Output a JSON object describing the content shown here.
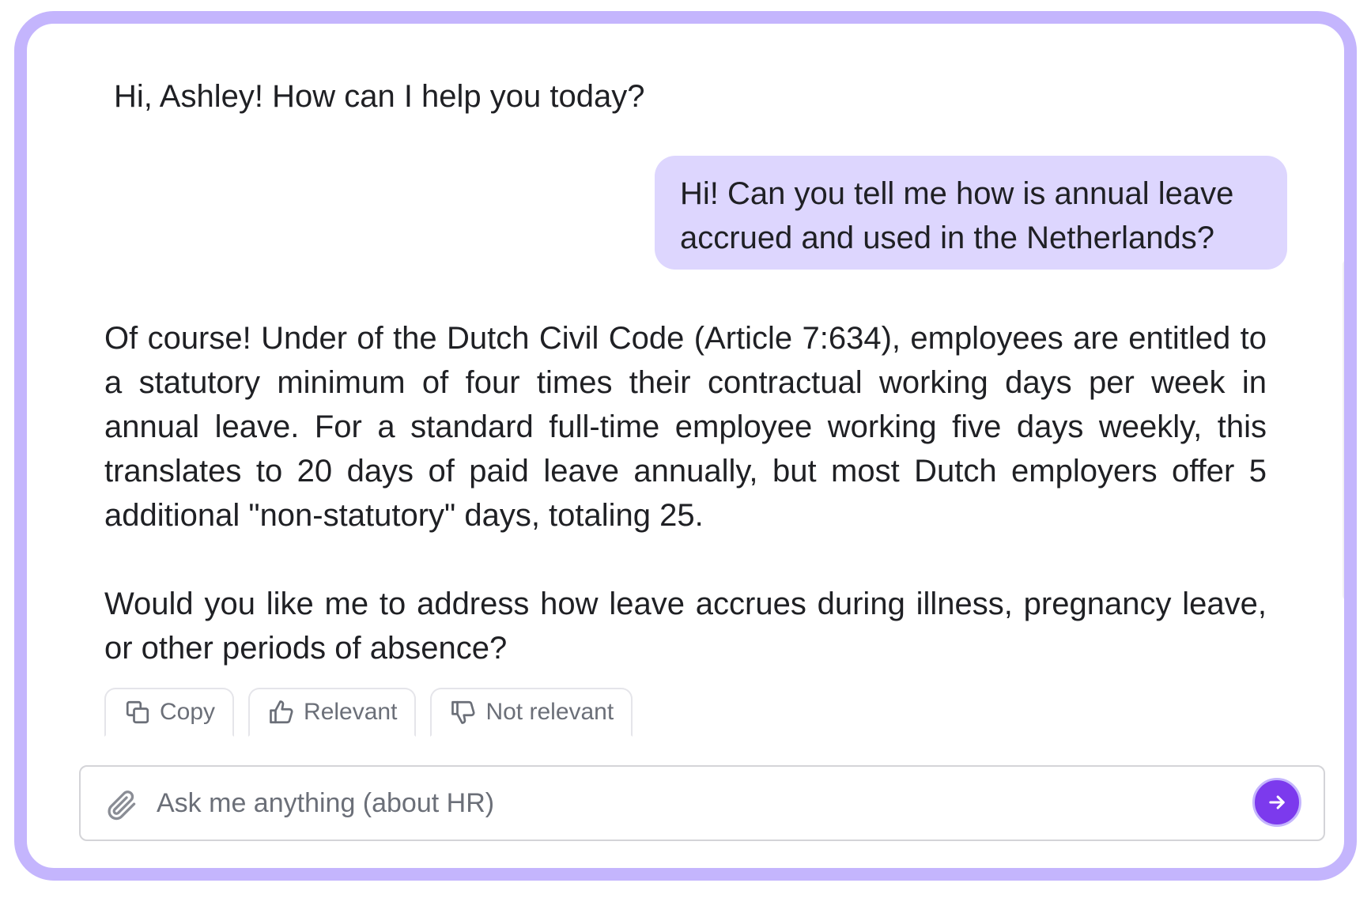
{
  "chat": {
    "greeting": "Hi, Ashley! How can I help you today?",
    "user_message_lines": [
      "Hi! Can you tell me how is annual leave",
      "accrued and used in the Netherlands?"
    ],
    "assistant_paragraphs": [
      "Of course! Under of the Dutch Civil Code (Article 7:634), employees are entitled to a statutory minimum of four times their contractual working days per week in annual leave. For a standard full-time employee working five days weekly, this translates to 20 days of paid leave annually, but most Dutch employers offer 5 additional \"non-statutory\" days, totaling 25.",
      "Would you like me to address how leave accrues during illness, pregnancy leave, or other periods of absence?"
    ]
  },
  "actions": {
    "copy_label": "Copy",
    "relevant_label": "Relevant",
    "not_relevant_label": "Not relevant"
  },
  "composer": {
    "placeholder": "Ask me anything (about HR)",
    "value": ""
  },
  "icons": {
    "copy": "copy-icon",
    "relevant": "thumbs-up-icon",
    "not_relevant": "thumbs-down-icon",
    "attach": "paperclip-icon",
    "send": "arrow-right-icon"
  },
  "colors": {
    "frame_border": "#c4b5fd",
    "user_bubble": "#ddd6fe",
    "send_button": "#7c3aed"
  }
}
